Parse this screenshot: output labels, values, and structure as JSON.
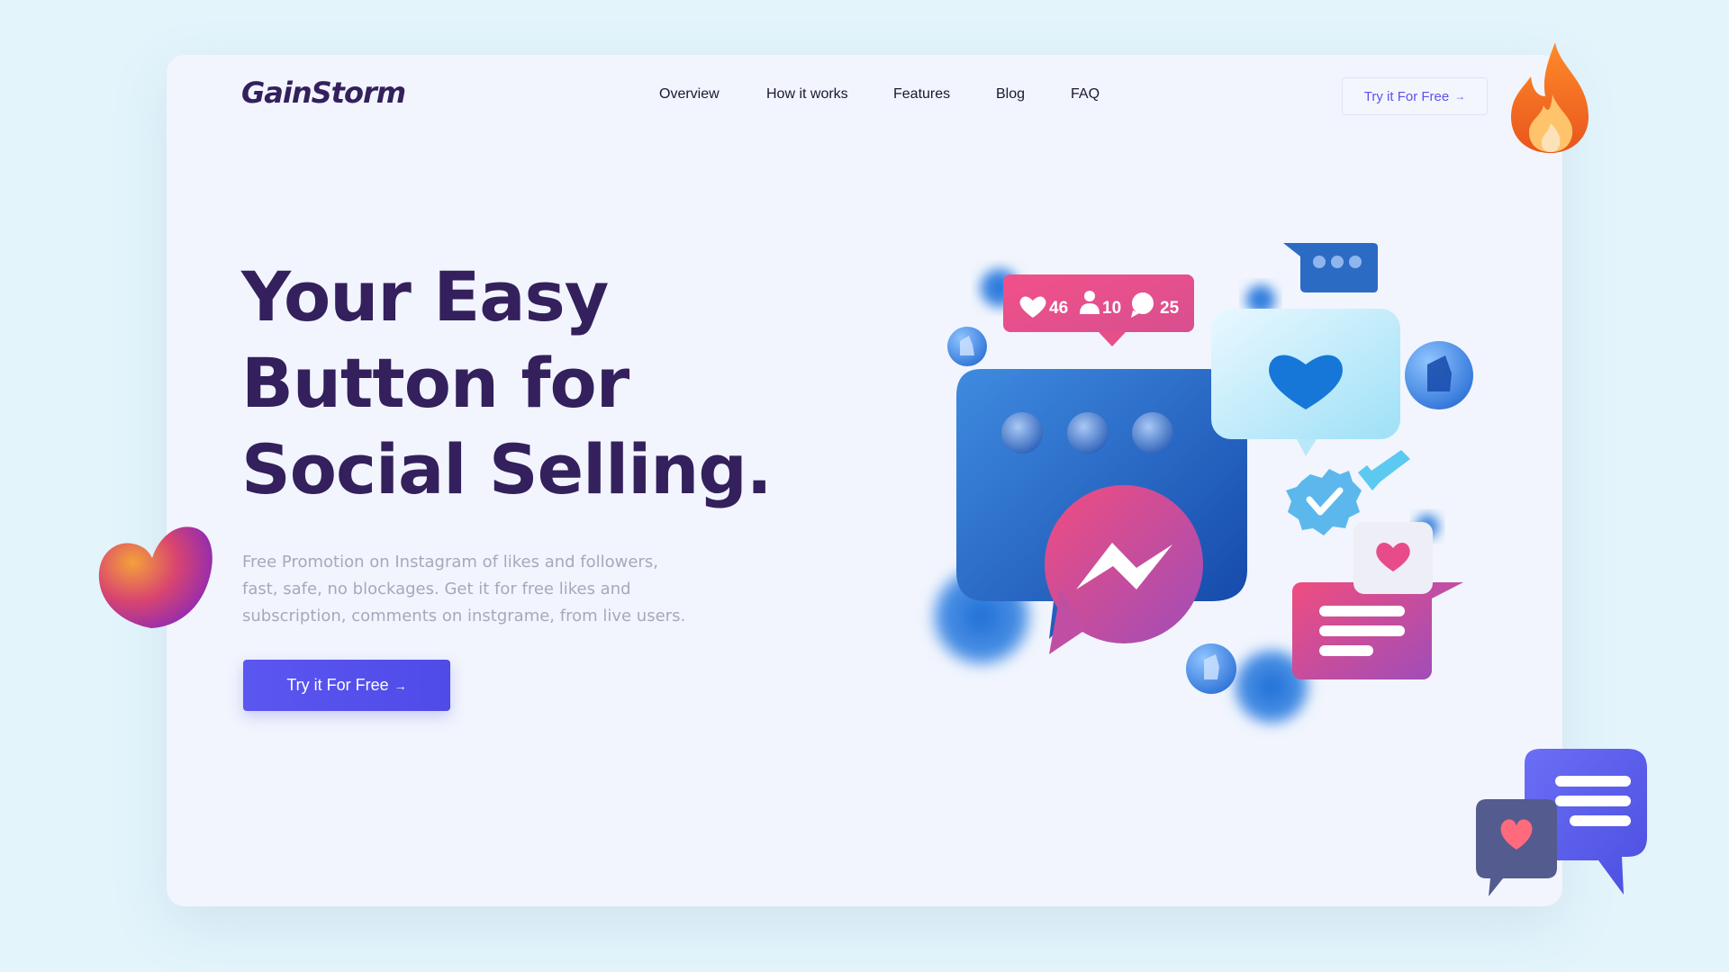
{
  "brand": {
    "logo": "GainStorm"
  },
  "nav": {
    "items": [
      {
        "label": "Overview"
      },
      {
        "label": "How it works"
      },
      {
        "label": "Features"
      },
      {
        "label": "Blog"
      },
      {
        "label": "FAQ"
      }
    ],
    "cta_label": "Try it For Free",
    "cta_arrow": "→"
  },
  "hero": {
    "title_lines": [
      "Your Easy",
      "Button for",
      "Social Selling."
    ],
    "description_lines": [
      "Free Promotion on Instagram of likes and followers,",
      "fast, safe, no blockages. Get it for free likes and",
      "subscription, comments on instgrame, from live users."
    ],
    "cta_label": "Try it For Free",
    "cta_arrow": "→"
  },
  "illustration": {
    "stats": {
      "likes": "46",
      "followers": "10",
      "comments": "25"
    }
  },
  "colors": {
    "background": "#e3f4fb",
    "card": "#f2f5fd",
    "heading": "#33205c",
    "accent": "#5b56f0",
    "muted_text": "#a5a9bc",
    "pink": "#ec4f86",
    "blue": "#1f6fd6"
  }
}
